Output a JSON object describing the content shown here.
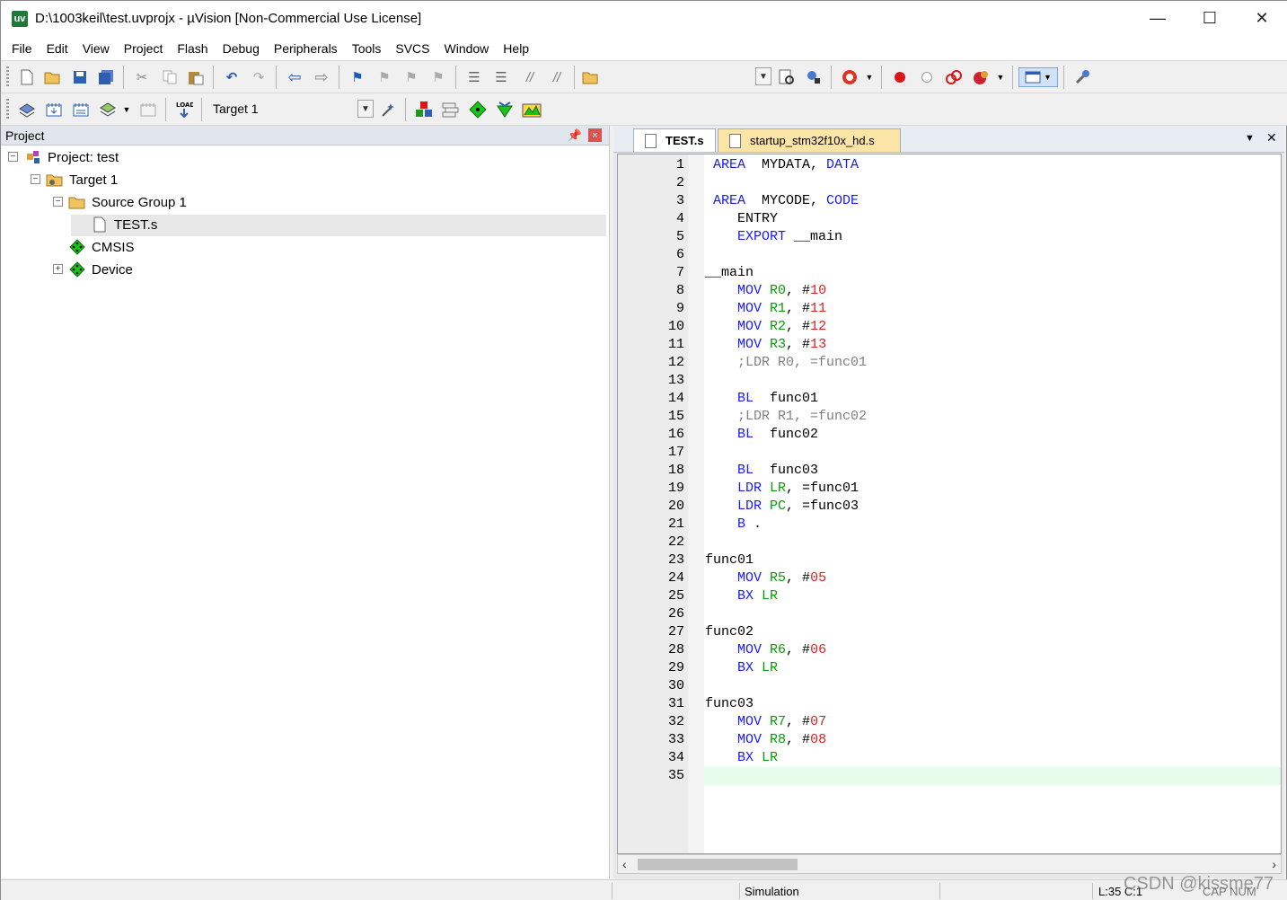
{
  "window": {
    "title": "D:\\1003keil\\test.uvprojx - µVision  [Non-Commercial Use License]",
    "app_icon": "uv",
    "controls": {
      "minimize": "—",
      "maximize": "☐",
      "close": "✕"
    }
  },
  "menu": [
    "File",
    "Edit",
    "View",
    "Project",
    "Flash",
    "Debug",
    "Peripherals",
    "Tools",
    "SVCS",
    "Window",
    "Help"
  ],
  "toolbar2": {
    "target_value": "Target 1"
  },
  "project_pane": {
    "title": "Project",
    "pin_icon": "📌",
    "close_icon": "×",
    "tree": {
      "project": "Project: test",
      "target": "Target 1",
      "group": "Source Group 1",
      "file": "TEST.s",
      "cmsis": "CMSIS",
      "device": "Device"
    }
  },
  "editor": {
    "tabs": [
      "TEST.s",
      "startup_stm32f10x_hd.s"
    ],
    "active_tab": "TEST.s",
    "current_line": 35,
    "lines": [
      [
        [
          "kw",
          " AREA"
        ],
        [
          "",
          "  MYDATA, "
        ],
        [
          "kw",
          "DATA"
        ]
      ],
      [],
      [
        [
          "kw",
          " AREA"
        ],
        [
          "",
          "  MYCODE, "
        ],
        [
          "kw",
          "CODE"
        ]
      ],
      [
        [
          "",
          "    ENTRY"
        ]
      ],
      [
        [
          "kw",
          "    EXPORT"
        ],
        [
          "",
          " __main"
        ]
      ],
      [],
      [
        [
          "",
          "__main"
        ]
      ],
      [
        [
          "kw",
          "    MOV"
        ],
        [
          "",
          " "
        ],
        [
          "reg",
          "R0"
        ],
        [
          "",
          ", #"
        ],
        [
          "num",
          "10"
        ]
      ],
      [
        [
          "kw",
          "    MOV"
        ],
        [
          "",
          " "
        ],
        [
          "reg",
          "R1"
        ],
        [
          "",
          ", #"
        ],
        [
          "num",
          "11"
        ]
      ],
      [
        [
          "kw",
          "    MOV"
        ],
        [
          "",
          " "
        ],
        [
          "reg",
          "R2"
        ],
        [
          "",
          ", #"
        ],
        [
          "num",
          "12"
        ]
      ],
      [
        [
          "kw",
          "    MOV"
        ],
        [
          "",
          " "
        ],
        [
          "reg",
          "R3"
        ],
        [
          "",
          ", #"
        ],
        [
          "num",
          "13"
        ]
      ],
      [
        [
          "cmt",
          "    ;LDR R0, =func01"
        ]
      ],
      [],
      [
        [
          "kw",
          "    BL"
        ],
        [
          "",
          "  func01"
        ]
      ],
      [
        [
          "cmt",
          "    ;LDR R1, =func02"
        ]
      ],
      [
        [
          "kw",
          "    BL"
        ],
        [
          "",
          "  func02"
        ]
      ],
      [],
      [
        [
          "kw",
          "    BL"
        ],
        [
          "",
          "  func03"
        ]
      ],
      [
        [
          "kw",
          "    LDR"
        ],
        [
          "",
          " "
        ],
        [
          "reg",
          "LR"
        ],
        [
          "",
          ", =func01"
        ]
      ],
      [
        [
          "kw",
          "    LDR"
        ],
        [
          "",
          " "
        ],
        [
          "reg",
          "PC"
        ],
        [
          "",
          ", =func03"
        ]
      ],
      [
        [
          "kw",
          "    B"
        ],
        [
          "",
          " ."
        ]
      ],
      [],
      [
        [
          "",
          "func01"
        ]
      ],
      [
        [
          "kw",
          "    MOV"
        ],
        [
          "",
          " "
        ],
        [
          "reg",
          "R5"
        ],
        [
          "",
          ", #"
        ],
        [
          "num",
          "05"
        ]
      ],
      [
        [
          "kw",
          "    BX"
        ],
        [
          "",
          " "
        ],
        [
          "reg",
          "LR"
        ]
      ],
      [],
      [
        [
          "",
          "func02"
        ]
      ],
      [
        [
          "kw",
          "    MOV"
        ],
        [
          "",
          " "
        ],
        [
          "reg",
          "R6"
        ],
        [
          "",
          ", #"
        ],
        [
          "num",
          "06"
        ]
      ],
      [
        [
          "kw",
          "    BX"
        ],
        [
          "",
          " "
        ],
        [
          "reg",
          "LR"
        ]
      ],
      [],
      [
        [
          "",
          "func03"
        ]
      ],
      [
        [
          "kw",
          "    MOV"
        ],
        [
          "",
          " "
        ],
        [
          "reg",
          "R7"
        ],
        [
          "",
          ", #"
        ],
        [
          "num",
          "07"
        ]
      ],
      [
        [
          "kw",
          "    MOV"
        ],
        [
          "",
          " "
        ],
        [
          "reg",
          "R8"
        ],
        [
          "",
          ", #"
        ],
        [
          "num",
          "08"
        ]
      ],
      [
        [
          "kw",
          "    BX"
        ],
        [
          "",
          " "
        ],
        [
          "reg",
          "LR"
        ]
      ],
      []
    ]
  },
  "statusbar": {
    "mode": "Simulation",
    "position": "L:35 C:1",
    "caps": "CAP NUM",
    "watermark": "CSDN @kissme77"
  },
  "colors": {
    "keyword": "#1a1aff",
    "register": "#0a9a0a",
    "number": "#e02020",
    "comment": "#808080",
    "current_line": "#e6fde9"
  }
}
